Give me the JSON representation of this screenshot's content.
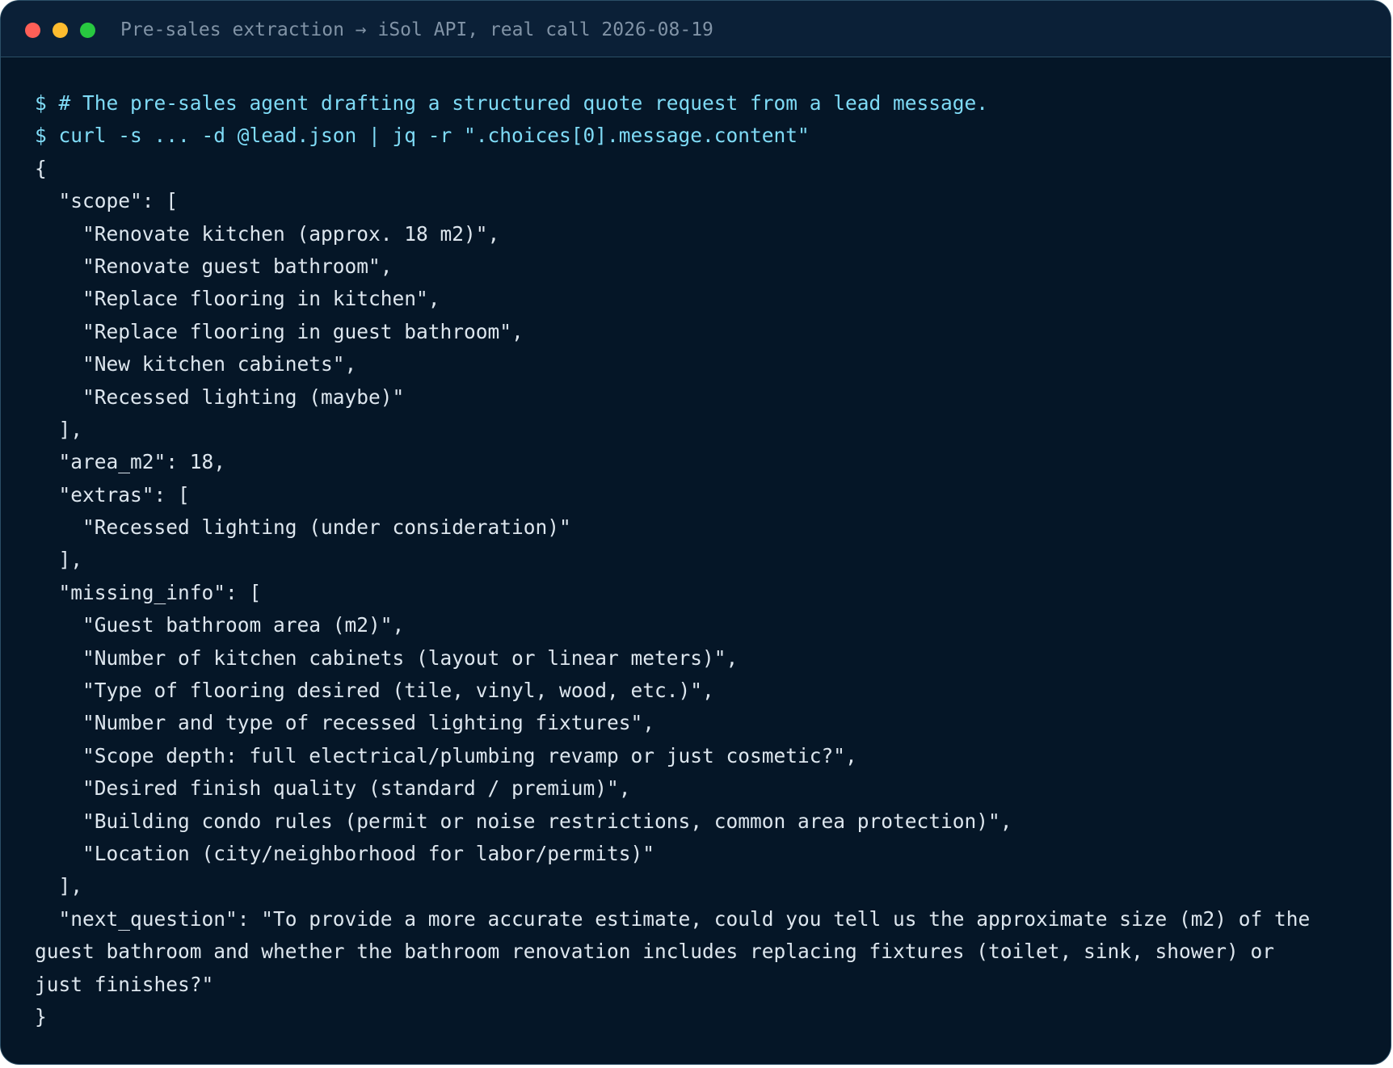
{
  "window": {
    "title": "Pre-sales extraction → iSol API, real call 2026-08-19"
  },
  "terminal": {
    "lines": [
      {
        "type": "cmd",
        "text": "$ # The pre-sales agent drafting a structured quote request from a lead message."
      },
      {
        "type": "cmd",
        "text": "$ curl -s ... -d @lead.json | jq -r \".choices[0].message.content\""
      },
      {
        "type": "out",
        "text": "{"
      },
      {
        "type": "out",
        "text": "  \"scope\": ["
      },
      {
        "type": "out",
        "text": "    \"Renovate kitchen (approx. 18 m2)\","
      },
      {
        "type": "out",
        "text": "    \"Renovate guest bathroom\","
      },
      {
        "type": "out",
        "text": "    \"Replace flooring in kitchen\","
      },
      {
        "type": "out",
        "text": "    \"Replace flooring in guest bathroom\","
      },
      {
        "type": "out",
        "text": "    \"New kitchen cabinets\","
      },
      {
        "type": "out",
        "text": "    \"Recessed lighting (maybe)\""
      },
      {
        "type": "out",
        "text": "  ],"
      },
      {
        "type": "out",
        "text": "  \"area_m2\": 18,"
      },
      {
        "type": "out",
        "text": "  \"extras\": ["
      },
      {
        "type": "out",
        "text": "    \"Recessed lighting (under consideration)\""
      },
      {
        "type": "out",
        "text": "  ],"
      },
      {
        "type": "out",
        "text": "  \"missing_info\": ["
      },
      {
        "type": "out",
        "text": "    \"Guest bathroom area (m2)\","
      },
      {
        "type": "out",
        "text": "    \"Number of kitchen cabinets (layout or linear meters)\","
      },
      {
        "type": "out",
        "text": "    \"Type of flooring desired (tile, vinyl, wood, etc.)\","
      },
      {
        "type": "out",
        "text": "    \"Number and type of recessed lighting fixtures\","
      },
      {
        "type": "out",
        "text": "    \"Scope depth: full electrical/plumbing revamp or just cosmetic?\","
      },
      {
        "type": "out",
        "text": "    \"Desired finish quality (standard / premium)\","
      },
      {
        "type": "out",
        "text": "    \"Building condo rules (permit or noise restrictions, common area protection)\","
      },
      {
        "type": "out",
        "text": "    \"Location (city/neighborhood for labor/permits)\""
      },
      {
        "type": "out",
        "text": "  ],"
      },
      {
        "type": "out",
        "text": "  \"next_question\": \"To provide a more accurate estimate, could you tell us the approximate size (m2) of the"
      },
      {
        "type": "out",
        "text": "guest bathroom and whether the bathroom renovation includes replacing fixtures (toilet, sink, shower) or"
      },
      {
        "type": "out",
        "text": "just finishes?\""
      },
      {
        "type": "out",
        "text": "}"
      }
    ]
  },
  "colors": {
    "background": "#051627",
    "titlebar": "#0b2037",
    "command_text": "#7fdbf6",
    "output_text": "#dde6ee",
    "title_text": "#8193a6"
  }
}
